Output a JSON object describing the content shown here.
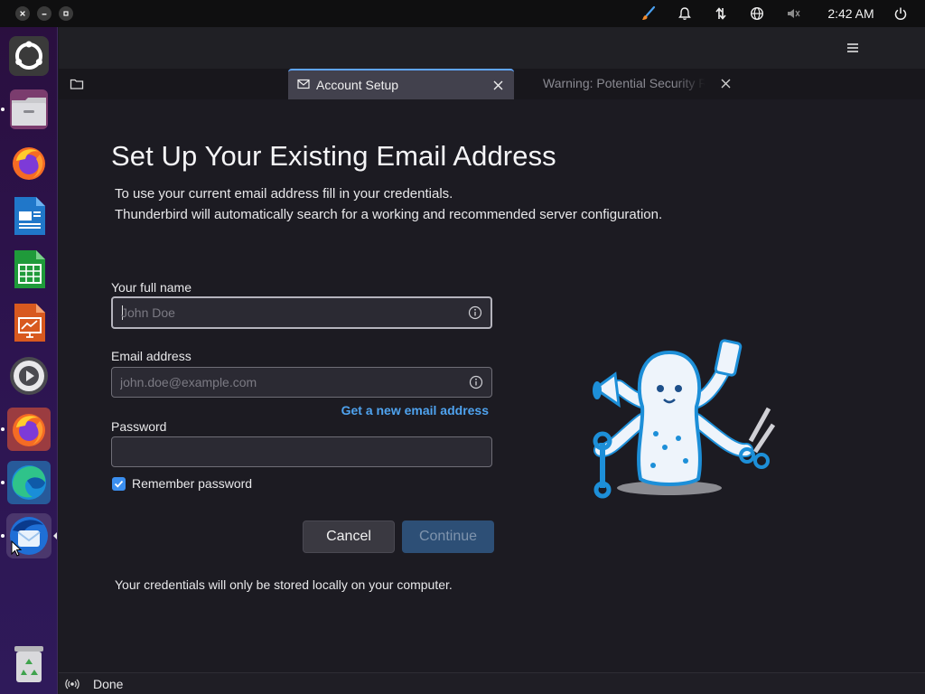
{
  "system": {
    "clock": "2:42 AM",
    "icons": [
      "paint-brush-icon",
      "bell-icon",
      "network-transfer-icon",
      "globe-icon",
      "speaker-muted-icon",
      "power-icon"
    ]
  },
  "dock": {
    "items": [
      {
        "name": "ubuntu-logo",
        "running": false
      },
      {
        "name": "files",
        "running": true
      },
      {
        "name": "firefox",
        "running": false
      },
      {
        "name": "libreoffice-writer",
        "running": false
      },
      {
        "name": "libreoffice-calc",
        "running": false
      },
      {
        "name": "libreoffice-impress",
        "running": false
      },
      {
        "name": "settings",
        "running": false
      },
      {
        "name": "firefox",
        "running": true
      },
      {
        "name": "edge",
        "running": true
      },
      {
        "name": "thunderbird",
        "running": true,
        "focused": true
      },
      {
        "name": "trash",
        "running": false
      }
    ]
  },
  "tabs": [
    {
      "label": "Account Setup",
      "active": true
    },
    {
      "label": "Warning: Potential Security Risk Ahead",
      "active": false
    }
  ],
  "setup": {
    "title": "Set Up Your Existing Email Address",
    "desc_line1": "To use your current email address fill in your credentials.",
    "desc_line2": "Thunderbird will automatically search for a working and recommended server configuration.",
    "name_label": "Your full name",
    "name_placeholder": "John Doe",
    "name_value": "",
    "email_label": "Email address",
    "email_placeholder": "john.doe@example.com",
    "email_value": "",
    "new_email_link": "Get a new email address",
    "password_label": "Password",
    "password_value": "",
    "remember_label": "Remember password",
    "remember_checked": true,
    "cancel_label": "Cancel",
    "continue_label": "Continue",
    "footer_note": "Your credentials will only be stored locally on your computer."
  },
  "status": {
    "text": "Done"
  },
  "colors": {
    "accent": "#60a5fa",
    "link": "#4fa3ef",
    "checkbox": "#3b8ff0",
    "continue_bg": "#2d4f76"
  }
}
